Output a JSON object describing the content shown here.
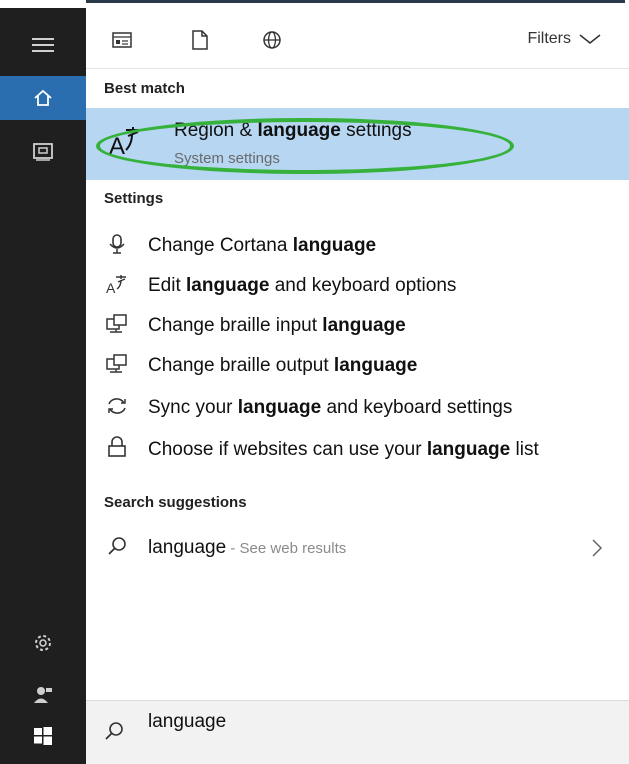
{
  "toolbar": {
    "filters_label": "Filters",
    "icons": [
      "apps-icon",
      "document-icon",
      "web-icon"
    ]
  },
  "best_match": {
    "heading": "Best match",
    "title_pre": "Region & ",
    "title_bold": "language",
    "title_post": " settings",
    "subtitle": "System settings"
  },
  "settings": {
    "heading": "Settings",
    "items": [
      {
        "pre": "Change Cortana ",
        "bold": "language",
        "post": "",
        "icon": "microphone-icon"
      },
      {
        "pre": "Edit ",
        "bold": "language",
        "post": " and keyboard options",
        "icon": "language-icon"
      },
      {
        "pre": "Change braille input ",
        "bold": "language",
        "post": "",
        "icon": "braille-icon"
      },
      {
        "pre": "Change braille output ",
        "bold": "language",
        "post": "",
        "icon": "braille-icon"
      },
      {
        "pre": "Sync your ",
        "bold": "language",
        "post": " and keyboard settings",
        "icon": "sync-icon"
      },
      {
        "pre": "Choose if websites can use your ",
        "bold": "language",
        "post": " list",
        "icon": "lock-icon"
      }
    ]
  },
  "suggestions": {
    "heading": "Search suggestions",
    "term": "language",
    "hint": " - See web results"
  },
  "search": {
    "value": "language"
  },
  "colors": {
    "sidebar": "#1f1f1f",
    "active": "#2b6eb0",
    "highlight": "#b7d6f2",
    "annotation": "#36b23c"
  }
}
